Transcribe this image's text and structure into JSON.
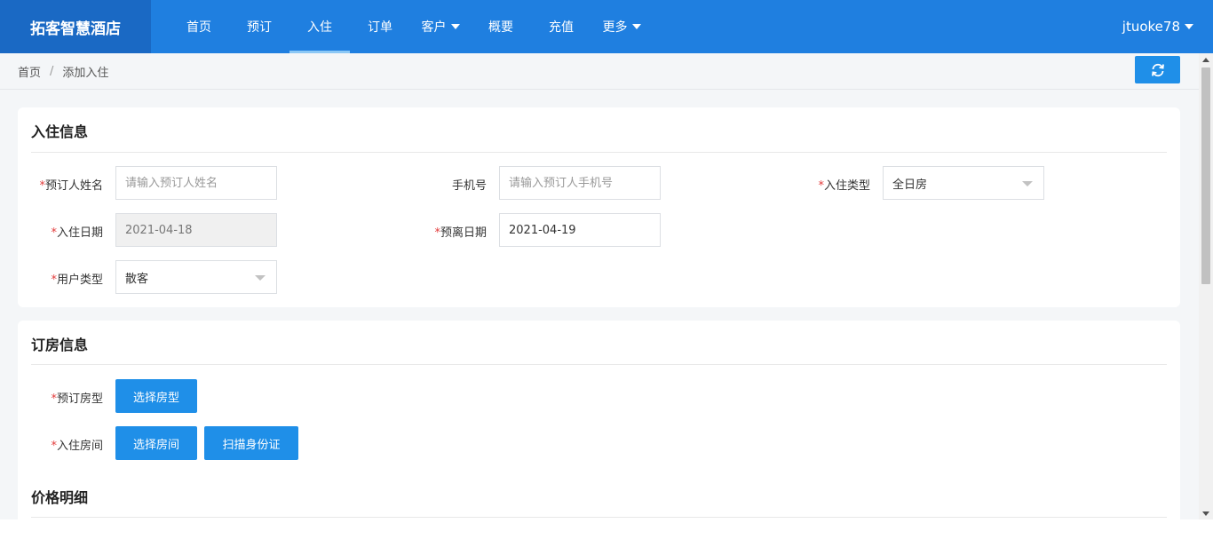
{
  "header": {
    "logo": "拓客智慧酒店",
    "nav": [
      {
        "label": "首页"
      },
      {
        "label": "预订"
      },
      {
        "label": "入住"
      },
      {
        "label": "订单"
      },
      {
        "label": "客户"
      },
      {
        "label": "概要"
      },
      {
        "label": "充值"
      },
      {
        "label": "更多"
      }
    ],
    "user": "jtuoke78"
  },
  "breadcrumb": {
    "home": "首页",
    "separator": "/",
    "current": "添加入住"
  },
  "icons": {
    "refresh": "refresh-icon",
    "dropdown": "caret-down-icon"
  },
  "checkin_info": {
    "title": "入住信息",
    "required_mark": "*",
    "booker_name": {
      "label": "预订人姓名",
      "placeholder": "请输入预订人姓名"
    },
    "phone": {
      "label": "手机号",
      "placeholder": "请输入预订人手机号"
    },
    "checkin_type": {
      "label": "入住类型",
      "value": "全日房"
    },
    "checkin_date": {
      "label": "入住日期",
      "value": "2021-04-18"
    },
    "departure_date": {
      "label": "预离日期",
      "value": "2021-04-19"
    },
    "user_type": {
      "label": "用户类型",
      "value": "散客"
    }
  },
  "room_info": {
    "title": "订房信息",
    "room_type": {
      "label": "预订房型",
      "button": "选择房型"
    },
    "room": {
      "label": "入住房间",
      "button": "选择房间",
      "scan_button": "扫描身份证"
    },
    "price_title": "价格明细"
  },
  "colors": {
    "header_bg": "#1f7fe0",
    "logo_bg": "#1a69c4",
    "button": "#1f8fe8",
    "required": "#e23c3c"
  }
}
